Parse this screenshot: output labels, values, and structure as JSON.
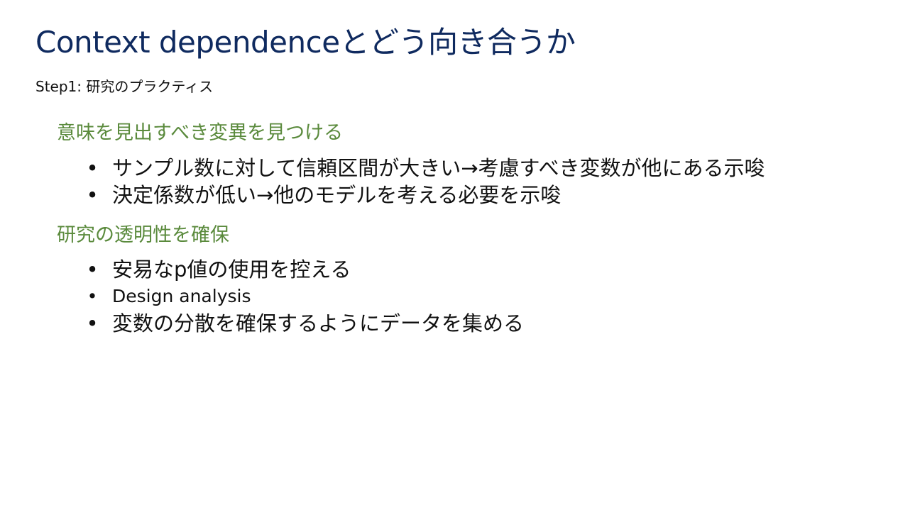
{
  "slide": {
    "title": "Context dependenceとどう向き合うか",
    "subtitle": "Step1: 研究のプラクティス",
    "sections": [
      {
        "heading": "意味を見出すべき変異を見つける",
        "bullets": [
          "サンプル数に対して信頼区間が大きい→考慮すべき変数が他にある示唆",
          "決定係数が低い→他のモデルを考える必要を示唆"
        ]
      },
      {
        "heading": "研究の透明性を確保",
        "bullets": [
          "安易なp値の使用を控える",
          "Design analysis",
          "変数の分散を確保するようにデータを集める"
        ]
      }
    ],
    "bullet_symbol": "•"
  },
  "colors": {
    "title": "#0f2a5f",
    "heading": "#5a8a3c",
    "body": "#111111",
    "background": "#ffffff"
  }
}
